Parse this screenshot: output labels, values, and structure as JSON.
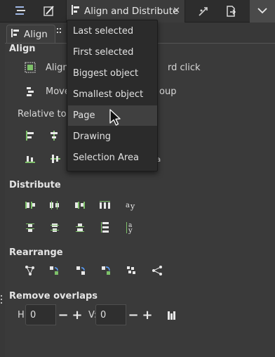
{
  "tabs": {
    "active_label": "Align and Distribute",
    "icons": [
      "xml-editor-icon",
      "fill-stroke-icon",
      "align-icon",
      "transform-icon",
      "export-icon",
      "chevron-down-icon"
    ]
  },
  "panel": {
    "subtab_label": "Align",
    "sections": {
      "align": "Align",
      "distribute": "Distribute",
      "rearrange": "Rearrange",
      "remove_overlaps": "Remove overlaps"
    },
    "align_option_1_prefix": "Align",
    "align_option_1_suffix": "rd click",
    "align_option_2_prefix": "Move",
    "align_option_2_suffix": "oup",
    "relative_to_label": "Relative to:",
    "h_label": "H:",
    "h_value": "0",
    "v_label": "V:",
    "v_value": "0"
  },
  "dropdown": {
    "items": [
      "Last selected",
      "First selected",
      "Biggest object",
      "Smallest object",
      "Page",
      "Drawing",
      "Selection Area"
    ],
    "hovered": "Page"
  },
  "colors": {
    "accent_green": "#7ec16a",
    "icon_white": "#ececec",
    "background": "#383838"
  }
}
